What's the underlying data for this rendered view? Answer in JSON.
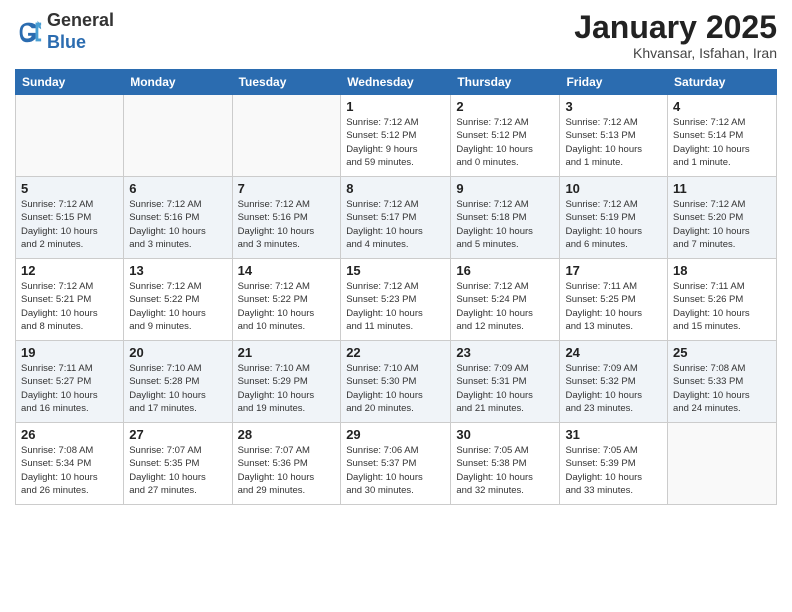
{
  "header": {
    "logo_line1": "General",
    "logo_line2": "Blue",
    "month_title": "January 2025",
    "subtitle": "Khvansar, Isfahan, Iran"
  },
  "days_of_week": [
    "Sunday",
    "Monday",
    "Tuesday",
    "Wednesday",
    "Thursday",
    "Friday",
    "Saturday"
  ],
  "weeks": [
    {
      "days": [
        {
          "number": "",
          "info": ""
        },
        {
          "number": "",
          "info": ""
        },
        {
          "number": "",
          "info": ""
        },
        {
          "number": "1",
          "info": "Sunrise: 7:12 AM\nSunset: 5:12 PM\nDaylight: 9 hours\nand 59 minutes."
        },
        {
          "number": "2",
          "info": "Sunrise: 7:12 AM\nSunset: 5:12 PM\nDaylight: 10 hours\nand 0 minutes."
        },
        {
          "number": "3",
          "info": "Sunrise: 7:12 AM\nSunset: 5:13 PM\nDaylight: 10 hours\nand 1 minute."
        },
        {
          "number": "4",
          "info": "Sunrise: 7:12 AM\nSunset: 5:14 PM\nDaylight: 10 hours\nand 1 minute."
        }
      ]
    },
    {
      "days": [
        {
          "number": "5",
          "info": "Sunrise: 7:12 AM\nSunset: 5:15 PM\nDaylight: 10 hours\nand 2 minutes."
        },
        {
          "number": "6",
          "info": "Sunrise: 7:12 AM\nSunset: 5:16 PM\nDaylight: 10 hours\nand 3 minutes."
        },
        {
          "number": "7",
          "info": "Sunrise: 7:12 AM\nSunset: 5:16 PM\nDaylight: 10 hours\nand 3 minutes."
        },
        {
          "number": "8",
          "info": "Sunrise: 7:12 AM\nSunset: 5:17 PM\nDaylight: 10 hours\nand 4 minutes."
        },
        {
          "number": "9",
          "info": "Sunrise: 7:12 AM\nSunset: 5:18 PM\nDaylight: 10 hours\nand 5 minutes."
        },
        {
          "number": "10",
          "info": "Sunrise: 7:12 AM\nSunset: 5:19 PM\nDaylight: 10 hours\nand 6 minutes."
        },
        {
          "number": "11",
          "info": "Sunrise: 7:12 AM\nSunset: 5:20 PM\nDaylight: 10 hours\nand 7 minutes."
        }
      ]
    },
    {
      "days": [
        {
          "number": "12",
          "info": "Sunrise: 7:12 AM\nSunset: 5:21 PM\nDaylight: 10 hours\nand 8 minutes."
        },
        {
          "number": "13",
          "info": "Sunrise: 7:12 AM\nSunset: 5:22 PM\nDaylight: 10 hours\nand 9 minutes."
        },
        {
          "number": "14",
          "info": "Sunrise: 7:12 AM\nSunset: 5:22 PM\nDaylight: 10 hours\nand 10 minutes."
        },
        {
          "number": "15",
          "info": "Sunrise: 7:12 AM\nSunset: 5:23 PM\nDaylight: 10 hours\nand 11 minutes."
        },
        {
          "number": "16",
          "info": "Sunrise: 7:12 AM\nSunset: 5:24 PM\nDaylight: 10 hours\nand 12 minutes."
        },
        {
          "number": "17",
          "info": "Sunrise: 7:11 AM\nSunset: 5:25 PM\nDaylight: 10 hours\nand 13 minutes."
        },
        {
          "number": "18",
          "info": "Sunrise: 7:11 AM\nSunset: 5:26 PM\nDaylight: 10 hours\nand 15 minutes."
        }
      ]
    },
    {
      "days": [
        {
          "number": "19",
          "info": "Sunrise: 7:11 AM\nSunset: 5:27 PM\nDaylight: 10 hours\nand 16 minutes."
        },
        {
          "number": "20",
          "info": "Sunrise: 7:10 AM\nSunset: 5:28 PM\nDaylight: 10 hours\nand 17 minutes."
        },
        {
          "number": "21",
          "info": "Sunrise: 7:10 AM\nSunset: 5:29 PM\nDaylight: 10 hours\nand 19 minutes."
        },
        {
          "number": "22",
          "info": "Sunrise: 7:10 AM\nSunset: 5:30 PM\nDaylight: 10 hours\nand 20 minutes."
        },
        {
          "number": "23",
          "info": "Sunrise: 7:09 AM\nSunset: 5:31 PM\nDaylight: 10 hours\nand 21 minutes."
        },
        {
          "number": "24",
          "info": "Sunrise: 7:09 AM\nSunset: 5:32 PM\nDaylight: 10 hours\nand 23 minutes."
        },
        {
          "number": "25",
          "info": "Sunrise: 7:08 AM\nSunset: 5:33 PM\nDaylight: 10 hours\nand 24 minutes."
        }
      ]
    },
    {
      "days": [
        {
          "number": "26",
          "info": "Sunrise: 7:08 AM\nSunset: 5:34 PM\nDaylight: 10 hours\nand 26 minutes."
        },
        {
          "number": "27",
          "info": "Sunrise: 7:07 AM\nSunset: 5:35 PM\nDaylight: 10 hours\nand 27 minutes."
        },
        {
          "number": "28",
          "info": "Sunrise: 7:07 AM\nSunset: 5:36 PM\nDaylight: 10 hours\nand 29 minutes."
        },
        {
          "number": "29",
          "info": "Sunrise: 7:06 AM\nSunset: 5:37 PM\nDaylight: 10 hours\nand 30 minutes."
        },
        {
          "number": "30",
          "info": "Sunrise: 7:05 AM\nSunset: 5:38 PM\nDaylight: 10 hours\nand 32 minutes."
        },
        {
          "number": "31",
          "info": "Sunrise: 7:05 AM\nSunset: 5:39 PM\nDaylight: 10 hours\nand 33 minutes."
        },
        {
          "number": "",
          "info": ""
        }
      ]
    }
  ]
}
